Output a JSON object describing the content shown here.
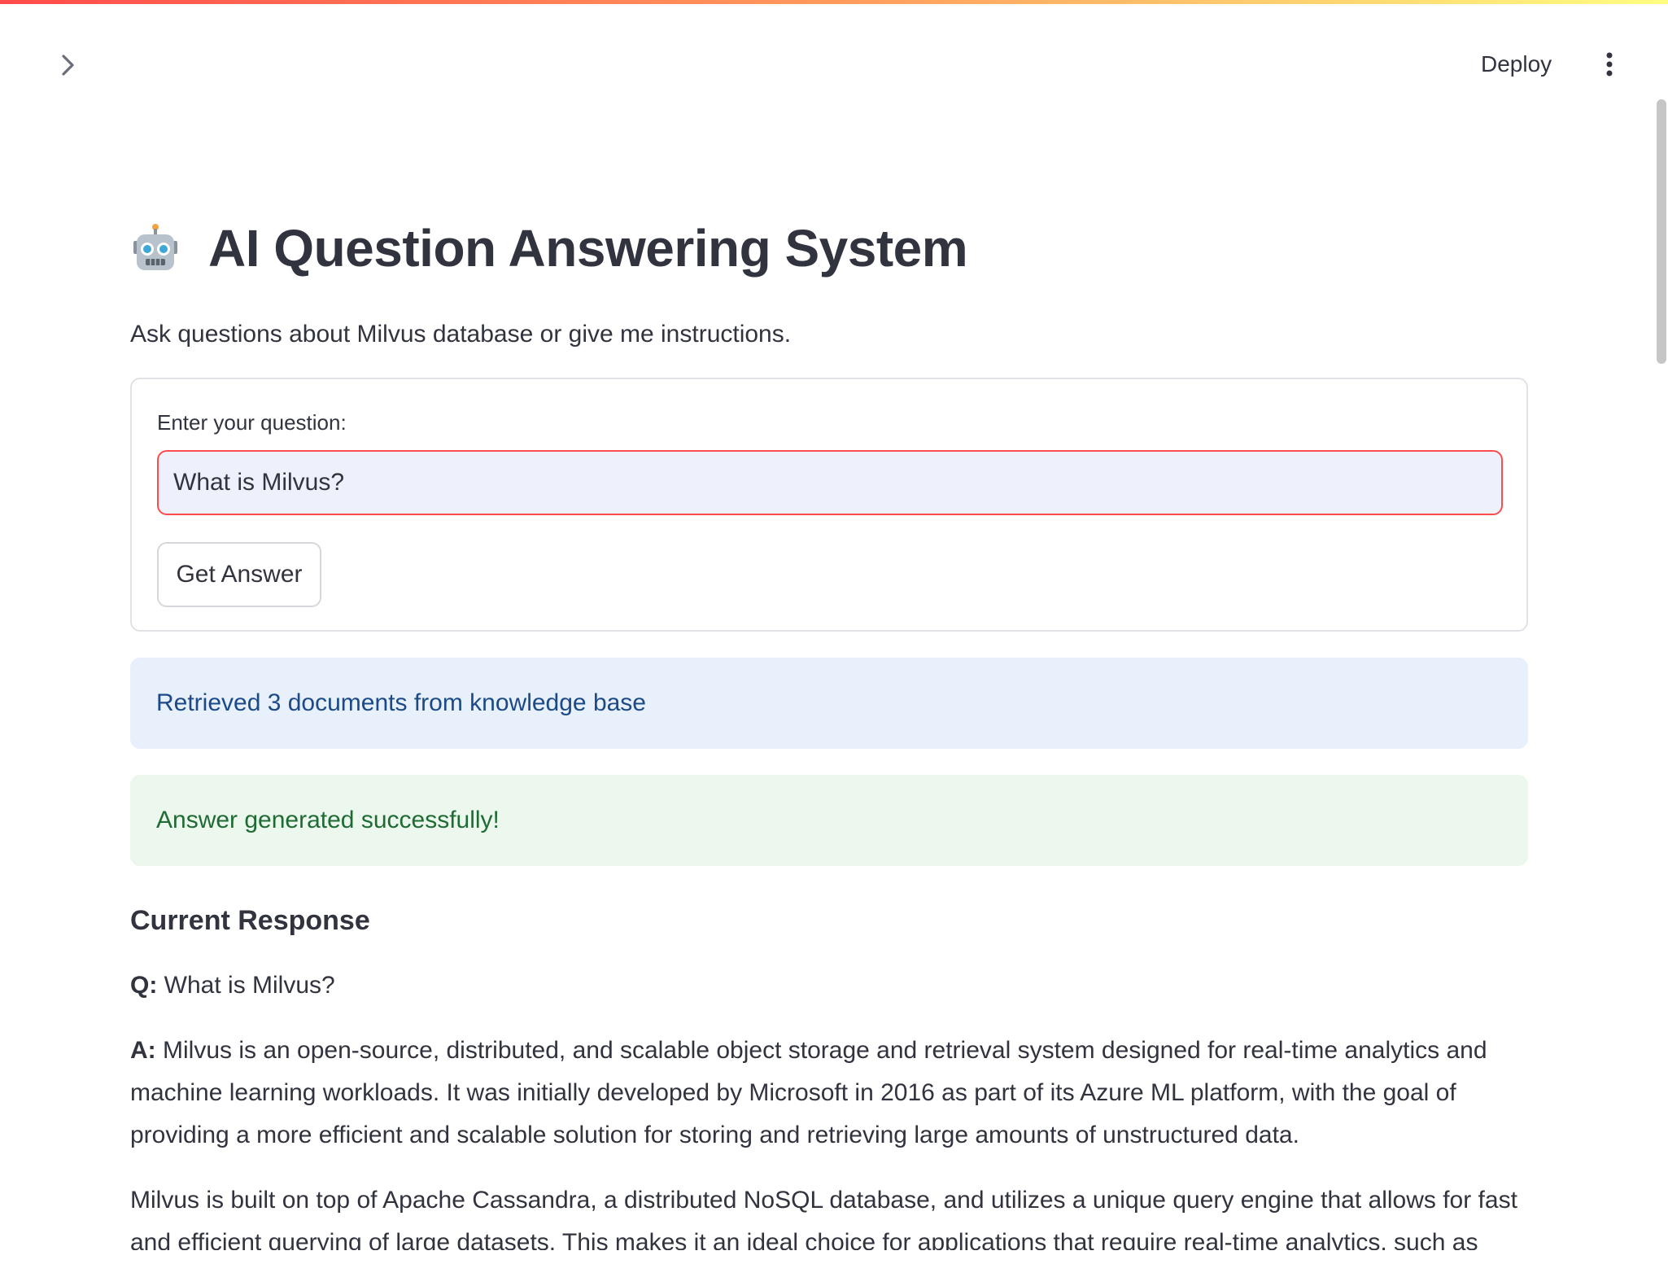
{
  "header": {
    "deploy_label": "Deploy",
    "sidebar_toggle_icon": "chevron-right-icon",
    "menu_icon": "vertical-dots-icon"
  },
  "main": {
    "title_icon": "robot-icon",
    "title": "AI Question Answering System",
    "subtitle": "Ask questions about Milvus database or give me instructions.",
    "form": {
      "input_label": "Enter your question:",
      "input_value": "What is Milvus?",
      "button_label": "Get Answer"
    },
    "info_alert": "Retrieved 3 documents from knowledge base",
    "success_alert": "Answer generated successfully!",
    "response": {
      "heading": "Current Response",
      "q_prefix": "Q:",
      "question": "What is Milvus?",
      "a_prefix": "A:",
      "answer_p1": "Milvus is an open-source, distributed, and scalable object storage and retrieval system designed for real-time analytics and machine learning workloads. It was initially developed by Microsoft in 2016 as part of its Azure ML platform, with the goal of providing a more efficient and scalable solution for storing and retrieving large amounts of unstructured data.",
      "answer_p2": "Milvus is built on top of Apache Cassandra, a distributed NoSQL database, and utilizes a unique query engine that allows for fast and efficient querying of large datasets. This makes it an ideal choice for applications that require real-time analytics, such as"
    }
  },
  "colors": {
    "accent": "#ff4b4b",
    "info_bg": "#e8f0fc",
    "info_text": "#1b4a87",
    "success_bg": "#ecf7ed",
    "success_text": "#1f6b34"
  }
}
